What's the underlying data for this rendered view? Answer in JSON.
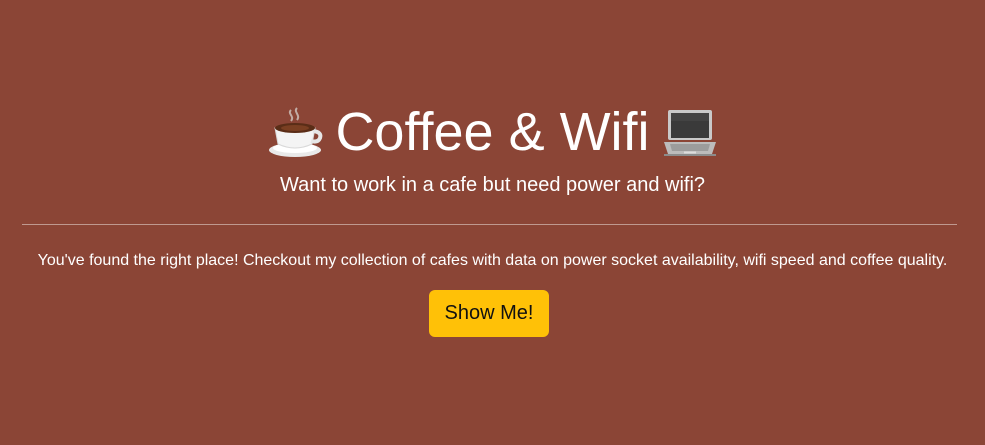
{
  "hero": {
    "title": "Coffee & Wifi",
    "title_left_icon": "coffee-cup-icon",
    "title_right_icon": "laptop-icon",
    "subtitle": "Want to work in a cafe but need power and wifi?",
    "lead": "You've found the right place! Checkout my collection of cafes with data on power socket availability, wifi speed and coffee quality.",
    "cta_label": "Show Me!"
  },
  "colors": {
    "background": "#8B4536",
    "button": "#FFC107",
    "text": "#FFFFFF"
  }
}
